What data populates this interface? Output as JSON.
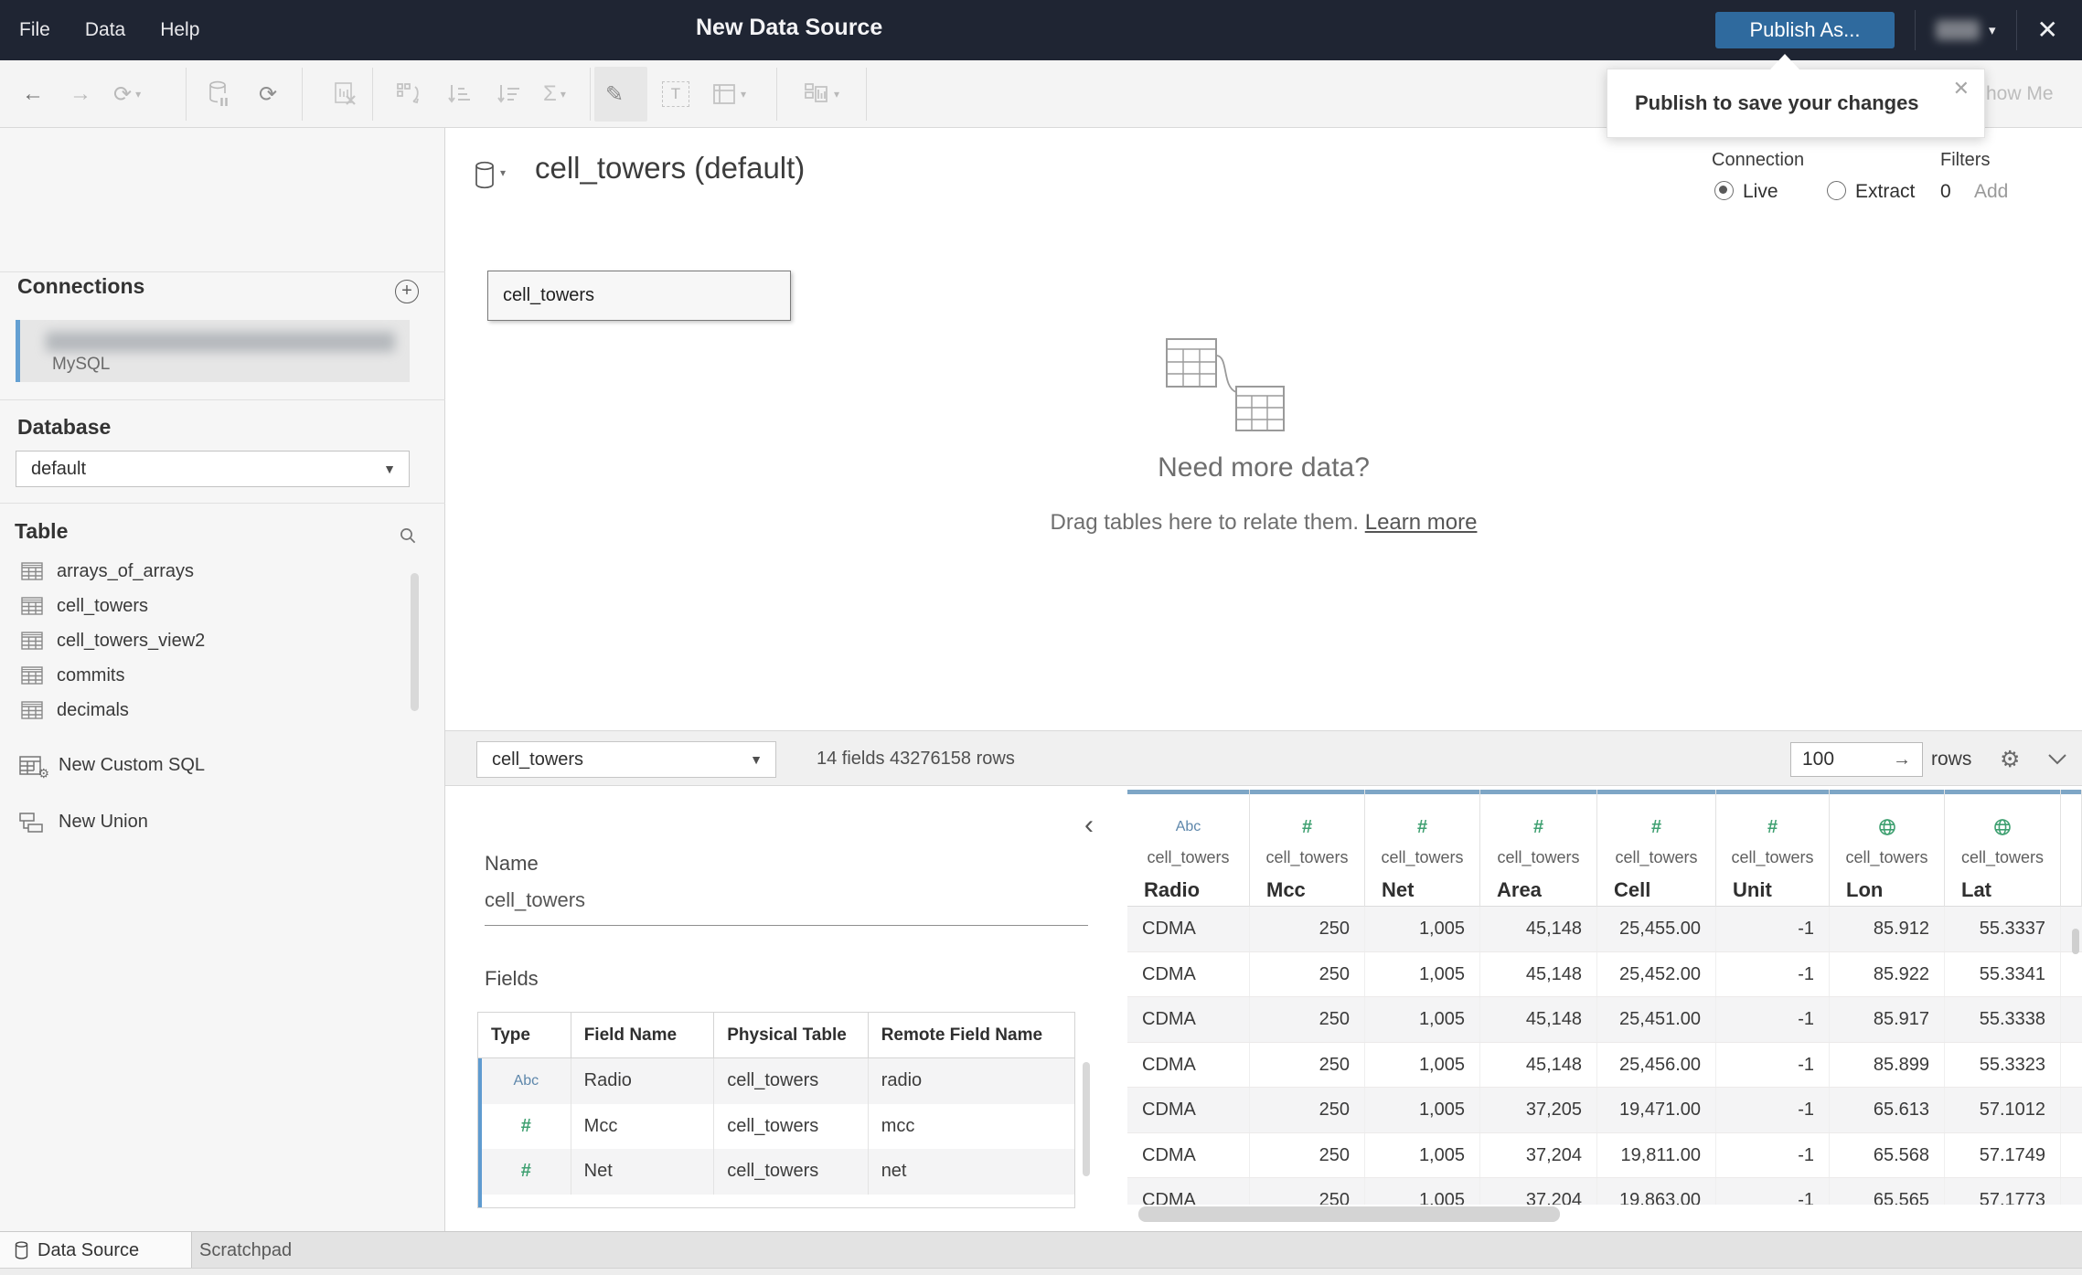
{
  "title_bar": {
    "menus": [
      "File",
      "Data",
      "Help"
    ],
    "title": "New Data Source",
    "publish_button": "Publish As...",
    "user_caret": "▾",
    "close_icon": "✕"
  },
  "tooltip": {
    "text": "Publish to save your changes",
    "close_icon": "✕"
  },
  "toolbar": {
    "show_me": "Show Me"
  },
  "sidebar": {
    "connections_title": "Connections",
    "add_icon": "+",
    "connection_type": "MySQL",
    "database_label": "Database",
    "database_value": "default",
    "table_label": "Table",
    "tables": [
      "arrays_of_arrays",
      "cell_towers",
      "cell_towers_view2",
      "commits",
      "decimals"
    ],
    "new_custom_sql": "New Custom SQL",
    "new_union": "New Union"
  },
  "canvas": {
    "datasource_title": "cell_towers (default)",
    "table_node_label": "cell_towers",
    "connection_label": "Connection",
    "live_label": "Live",
    "extract_label": "Extract",
    "filters_label": "Filters",
    "filters_count": "0",
    "filters_add_label": "Add",
    "empty_title": "Need more data?",
    "empty_subtitle": "Drag tables here to relate them.",
    "empty_link_label": "Learn more"
  },
  "preview_bar": {
    "table_selector_value": "cell_towers",
    "summary": "14 fields 43276158 rows",
    "row_count_value": "100",
    "rows_label": "rows"
  },
  "metadata": {
    "collapse_icon": "‹",
    "name_label": "Name",
    "name_value": "cell_towers",
    "fields_label": "Fields",
    "field_columns": [
      "Type",
      "Field Name",
      "Physical Table",
      "Remote Field Name"
    ],
    "field_rows": [
      {
        "type": "text",
        "glyph": "Abc",
        "field_name": "Radio",
        "physical_table": "cell_towers",
        "remote_field": "radio"
      },
      {
        "type": "number",
        "glyph": "#",
        "field_name": "Mcc",
        "physical_table": "cell_towers",
        "remote_field": "mcc"
      },
      {
        "type": "number",
        "glyph": "#",
        "field_name": "Net",
        "physical_table": "cell_towers",
        "remote_field": "net"
      }
    ]
  },
  "data_grid": {
    "columns": [
      {
        "type": "text",
        "glyph": "Abc",
        "table": "cell_towers",
        "name": "Radio"
      },
      {
        "type": "number",
        "glyph": "#",
        "table": "cell_towers",
        "name": "Mcc"
      },
      {
        "type": "number",
        "glyph": "#",
        "table": "cell_towers",
        "name": "Net"
      },
      {
        "type": "number",
        "glyph": "#",
        "table": "cell_towers",
        "name": "Area"
      },
      {
        "type": "number",
        "glyph": "#",
        "table": "cell_towers",
        "name": "Cell"
      },
      {
        "type": "number",
        "glyph": "#",
        "table": "cell_towers",
        "name": "Unit"
      },
      {
        "type": "geo",
        "glyph": "globe",
        "table": "cell_towers",
        "name": "Lon"
      },
      {
        "type": "geo",
        "glyph": "globe",
        "table": "cell_towers",
        "name": "Lat"
      }
    ],
    "rows": [
      [
        "CDMA",
        "250",
        "1,005",
        "45,148",
        "25,455.00",
        "-1",
        "85.912",
        "55.3337"
      ],
      [
        "CDMA",
        "250",
        "1,005",
        "45,148",
        "25,452.00",
        "-1",
        "85.922",
        "55.3341"
      ],
      [
        "CDMA",
        "250",
        "1,005",
        "45,148",
        "25,451.00",
        "-1",
        "85.917",
        "55.3338"
      ],
      [
        "CDMA",
        "250",
        "1,005",
        "45,148",
        "25,456.00",
        "-1",
        "85.899",
        "55.3323"
      ],
      [
        "CDMA",
        "250",
        "1,005",
        "37,205",
        "19,471.00",
        "-1",
        "65.613",
        "57.1012"
      ],
      [
        "CDMA",
        "250",
        "1,005",
        "37,204",
        "19,811.00",
        "-1",
        "65.568",
        "57.1749"
      ],
      [
        "CDMA",
        "250",
        "1,005",
        "37,204",
        "19,863.00",
        "-1",
        "65.565",
        "57.1773"
      ]
    ]
  },
  "tabs": {
    "data_source_label": "Data Source",
    "scratchpad_label": "Scratchpad"
  },
  "colors": {
    "titlebar_navy": "#1f2533",
    "publish_blue": "#2f6a9e",
    "column_bar_blue": "#7ea6c6",
    "row_accent_blue": "#5f9bd0",
    "field_green": "#3fa071",
    "field_text_blue": "#5e87ab"
  }
}
